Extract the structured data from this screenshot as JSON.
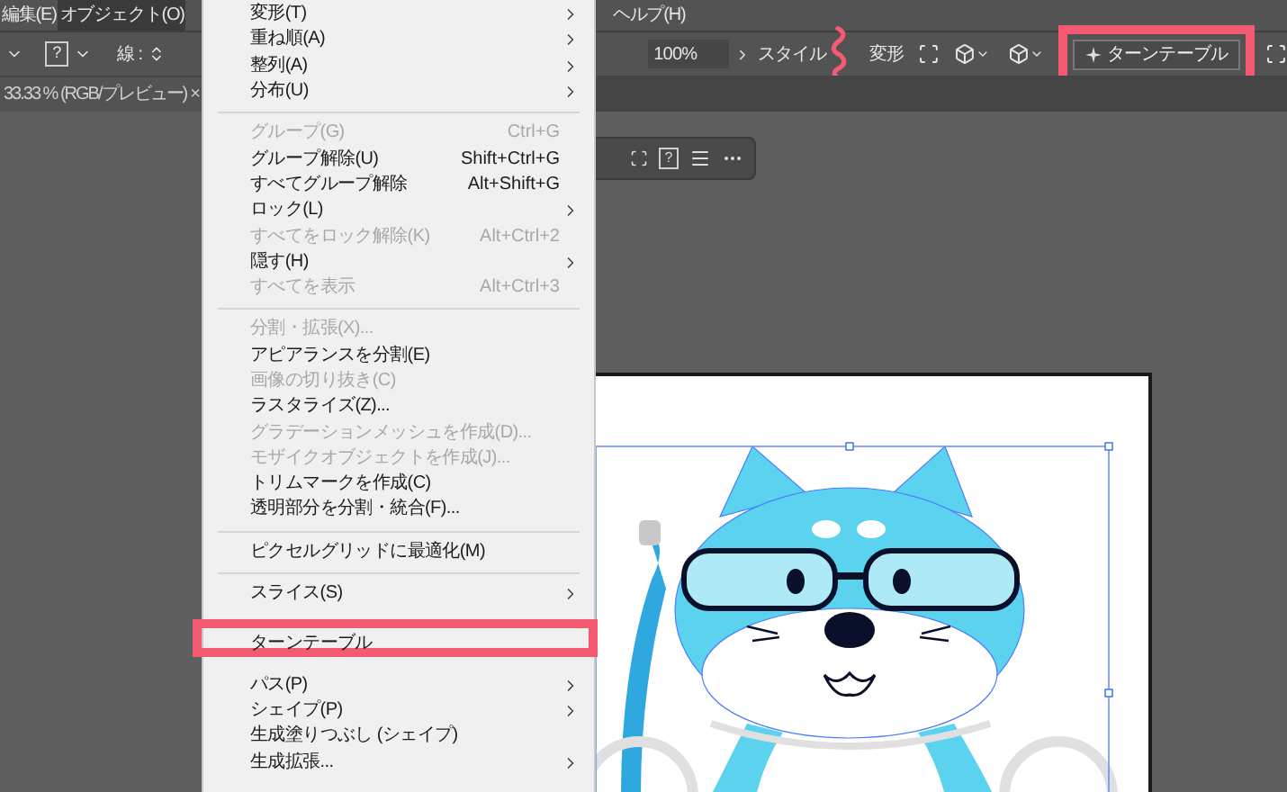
{
  "menu_bar": [
    {
      "label": "編集(E)",
      "selected": false
    },
    {
      "label": "オブジェクト(O)",
      "selected": true
    },
    {
      "label": "ヘルプ(H)",
      "selected": false
    }
  ],
  "control_bar": {
    "stroke_label": "線 :",
    "help_box": "?",
    "zoom_value": "100%",
    "style_label": "スタイル",
    "transform_label": "変形",
    "turntable_button": {
      "label": "ターンテーブル",
      "annotated": true
    }
  },
  "document_tab": {
    "title": "33.33 % (RGB/プレビュー)",
    "close": "×"
  },
  "floating_toolbar": {
    "help_box": "?"
  },
  "object_menu": [
    {
      "kind": "item",
      "label": "変形(T)",
      "submenu": true,
      "disabled": false,
      "annotated": false
    },
    {
      "kind": "item",
      "label": "重ね順(A)",
      "submenu": true,
      "disabled": false,
      "annotated": false
    },
    {
      "kind": "item",
      "label": "整列(A)",
      "submenu": true,
      "disabled": false,
      "annotated": false
    },
    {
      "kind": "item",
      "label": "分布(U)",
      "submenu": true,
      "disabled": false,
      "annotated": false
    },
    {
      "kind": "separator"
    },
    {
      "kind": "item",
      "label": "グループ(G)",
      "shortcut": "Ctrl+G",
      "submenu": false,
      "disabled": true,
      "annotated": false
    },
    {
      "kind": "item",
      "label": "グループ解除(U)",
      "shortcut": "Shift+Ctrl+G",
      "submenu": false,
      "disabled": false,
      "annotated": false
    },
    {
      "kind": "item",
      "label": "すべてグループ解除",
      "shortcut": "Alt+Shift+G",
      "submenu": false,
      "disabled": false,
      "annotated": false
    },
    {
      "kind": "item",
      "label": "ロック(L)",
      "submenu": true,
      "disabled": false,
      "annotated": false
    },
    {
      "kind": "item",
      "label": "すべてをロック解除(K)",
      "shortcut": "Alt+Ctrl+2",
      "submenu": false,
      "disabled": true,
      "annotated": false
    },
    {
      "kind": "item",
      "label": "隠す(H)",
      "submenu": true,
      "disabled": false,
      "annotated": false
    },
    {
      "kind": "item",
      "label": "すべてを表示",
      "shortcut": "Alt+Ctrl+3",
      "submenu": false,
      "disabled": true,
      "annotated": false
    },
    {
      "kind": "separator"
    },
    {
      "kind": "item",
      "label": "分割・拡張(X)...",
      "submenu": false,
      "disabled": true,
      "annotated": false
    },
    {
      "kind": "item",
      "label": "アピアランスを分割(E)",
      "submenu": false,
      "disabled": false,
      "annotated": false
    },
    {
      "kind": "item",
      "label": "画像の切り抜き(C)",
      "submenu": false,
      "disabled": true,
      "annotated": false
    },
    {
      "kind": "item",
      "label": "ラスタライズ(Z)...",
      "submenu": false,
      "disabled": false,
      "annotated": false
    },
    {
      "kind": "item",
      "label": "グラデーションメッシュを作成(D)...",
      "submenu": false,
      "disabled": true,
      "annotated": false
    },
    {
      "kind": "item",
      "label": "モザイクオブジェクトを作成(J)...",
      "submenu": false,
      "disabled": true,
      "annotated": false
    },
    {
      "kind": "item",
      "label": "トリムマークを作成(C)",
      "submenu": false,
      "disabled": false,
      "annotated": false
    },
    {
      "kind": "item",
      "label": "透明部分を分割・統合(F)...",
      "submenu": false,
      "disabled": false,
      "annotated": false
    },
    {
      "kind": "separator"
    },
    {
      "kind": "item",
      "label": "ピクセルグリッドに最適化(M)",
      "submenu": false,
      "disabled": false,
      "annotated": false
    },
    {
      "kind": "separator"
    },
    {
      "kind": "item",
      "label": "スライス(S)",
      "submenu": true,
      "disabled": false,
      "annotated": false
    },
    {
      "kind": "item",
      "label": "ターンテーブル",
      "submenu": false,
      "disabled": false,
      "annotated": true
    },
    {
      "kind": "item",
      "label": "パス(P)",
      "submenu": true,
      "disabled": false,
      "annotated": false
    },
    {
      "kind": "item",
      "label": "シェイプ(P)",
      "submenu": true,
      "disabled": false,
      "annotated": false
    },
    {
      "kind": "item",
      "label": "生成塗りつぶし (シェイプ)",
      "submenu": false,
      "disabled": false,
      "annotated": false
    },
    {
      "kind": "item",
      "label": "生成拡張...",
      "submenu": true,
      "disabled": false,
      "annotated": false
    }
  ]
}
